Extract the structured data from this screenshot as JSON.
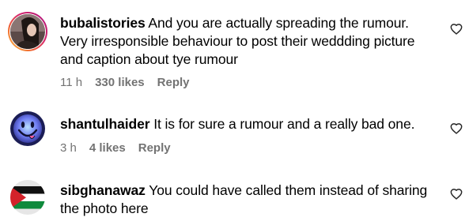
{
  "comments": [
    {
      "username": "bubalistories",
      "text": "And you are actually spreading the rumour. Very irresponsible behaviour to post their weddding picture and caption about tye rumour",
      "time": "11 h",
      "likes": "330 likes",
      "reply": "Reply",
      "avatar_icon": "user-photo-avatar",
      "like_icon": "heart-outline-icon"
    },
    {
      "username": "shantulhaider",
      "text": "It is for sure a rumour and a really bad one.",
      "time": "3 h",
      "likes": "4 likes",
      "reply": "Reply",
      "avatar_icon": "smiley-face-avatar",
      "like_icon": "heart-outline-icon"
    },
    {
      "username": "sibghanawaz",
      "text": "You could have called them instead of sharing the photo here",
      "avatar_icon": "palestine-flag-avatar",
      "like_icon": "heart-outline-icon"
    }
  ],
  "colors": {
    "meta_text": "#737373",
    "story_ring_start": "#f9c64a",
    "story_ring_end": "#a31ea3",
    "smiley_bg": "#6f7cf2"
  }
}
